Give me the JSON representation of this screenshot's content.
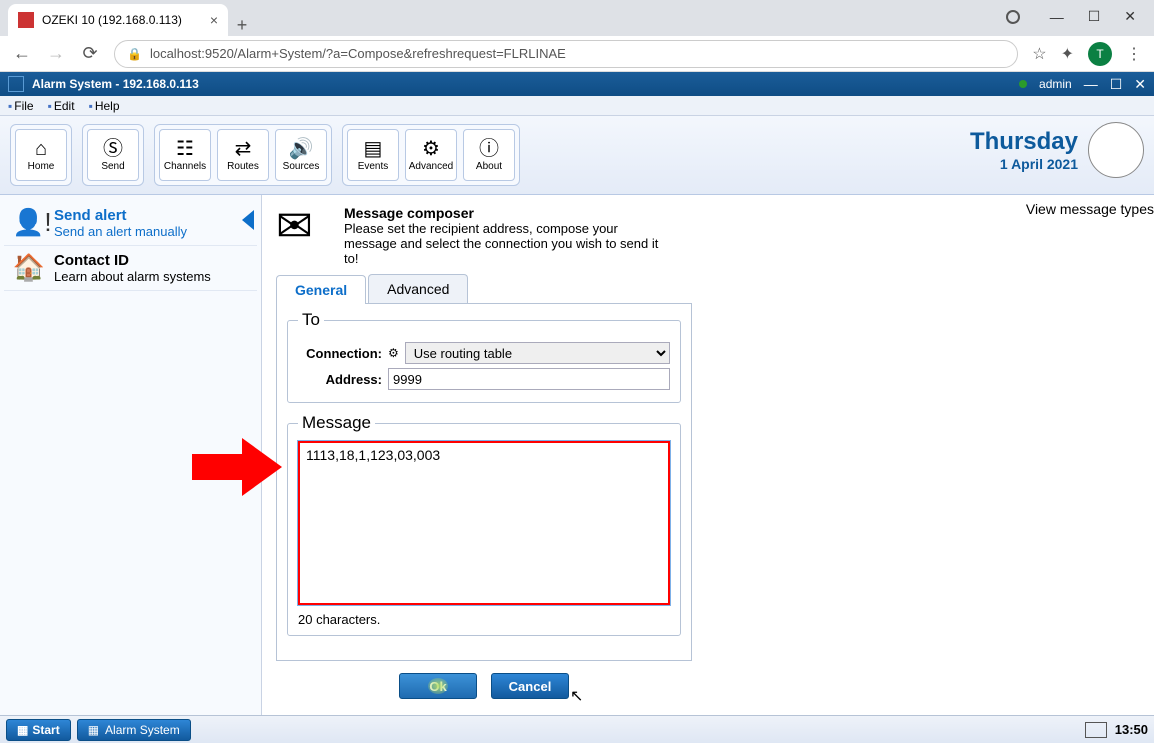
{
  "browser": {
    "tab_title": "OZEKI 10 (192.168.0.113)",
    "url": "localhost:9520/Alarm+System/?a=Compose&refreshrequest=FLRLINAE",
    "avatar_letter": "T"
  },
  "app": {
    "title": "Alarm System - 192.168.0.113",
    "user": "admin"
  },
  "menu": {
    "file": "File",
    "edit": "Edit",
    "help": "Help"
  },
  "toolbar": {
    "home": "Home",
    "send": "Send",
    "channels": "Channels",
    "routes": "Routes",
    "sources": "Sources",
    "events": "Events",
    "advanced": "Advanced",
    "about": "About"
  },
  "date": {
    "weekday": "Thursday",
    "full": "1 April 2021"
  },
  "sidebar": {
    "send_alert": {
      "title": "Send alert",
      "sub": "Send an alert manually"
    },
    "contact_id": {
      "title": "Contact ID",
      "sub": "Learn about alarm systems"
    }
  },
  "composer": {
    "title": "Message composer",
    "desc": "Please set the recipient address, compose your message and select the connection you wish to send it to!",
    "view_types": "View message types",
    "tab_general": "General",
    "tab_advanced": "Advanced",
    "to_legend": "To",
    "connection_label": "Connection:",
    "connection_value": "Use routing table",
    "address_label": "Address:",
    "address_value": "9999",
    "message_legend": "Message",
    "message_value": "1113,18,1,123,03,003",
    "counter": "20 characters.",
    "ok": "Ok",
    "cancel": "Cancel"
  },
  "taskbar": {
    "start": "Start",
    "app": "Alarm System",
    "time": "13:50"
  }
}
